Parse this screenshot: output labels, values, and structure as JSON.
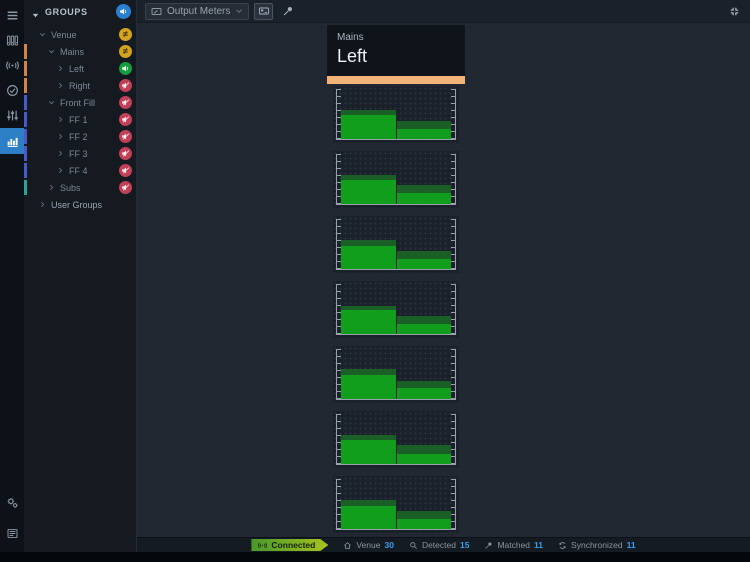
{
  "colors": {
    "accent_orange": "#f2b279",
    "rail_active_blue": "#2c7fc5",
    "meter_green_bright": "#129e1d",
    "meter_green_dark": "#1a5f25",
    "badge_mixed_yellow": "#d3a31f",
    "badge_unmuted_green": "#169b40",
    "badge_muted_red": "#c04058",
    "status_number_blue": "#3f9fe8",
    "group_bar_orange": "#cd854f",
    "group_bar_indigo": "#4a5ac2",
    "group_bar_teal": "#2ea39b"
  },
  "rail": {
    "items": [
      {
        "name": "rail-item-menu",
        "icon": "menu-icon",
        "active": false
      },
      {
        "name": "rail-item-amplifiers",
        "icon": "amplifiers-icon",
        "active": false
      },
      {
        "name": "rail-item-network",
        "icon": "signal-icon",
        "active": false
      },
      {
        "name": "rail-item-check",
        "icon": "check-circle-icon",
        "active": false
      },
      {
        "name": "rail-item-tuning",
        "icon": "eq-sliders-icon",
        "active": false
      },
      {
        "name": "rail-item-meters",
        "icon": "bar-meters-icon",
        "active": true
      }
    ],
    "bottom_items": [
      {
        "name": "rail-item-settings",
        "icon": "gears-icon",
        "active": false
      },
      {
        "name": "rail-item-log",
        "icon": "news-icon",
        "active": false
      }
    ]
  },
  "groups_panel": {
    "header": {
      "label": "GROUPS"
    },
    "tree": [
      {
        "label": "Venue",
        "level": 1,
        "expanded": true,
        "color": null,
        "badge": "mixed"
      },
      {
        "label": "Mains",
        "level": 2,
        "expanded": true,
        "color": "#cd854f",
        "badge": "mixed"
      },
      {
        "label": "Left",
        "level": 3,
        "expanded": false,
        "color": "#cd854f",
        "badge": "unmuted"
      },
      {
        "label": "Right",
        "level": 3,
        "expanded": false,
        "color": "#cd854f",
        "badge": "muted"
      },
      {
        "label": "Front Fill",
        "level": 2,
        "expanded": true,
        "color": "#4a5ac2",
        "badge": "muted"
      },
      {
        "label": "FF 1",
        "level": 3,
        "expanded": false,
        "color": "#4a5ac2",
        "badge": "muted"
      },
      {
        "label": "FF 2",
        "level": 3,
        "expanded": false,
        "color": "#4a5ac2",
        "badge": "muted"
      },
      {
        "label": "FF 3",
        "level": 3,
        "expanded": false,
        "color": "#4a5ac2",
        "badge": "muted"
      },
      {
        "label": "FF 4",
        "level": 3,
        "expanded": false,
        "color": "#4a5ac2",
        "badge": "muted"
      },
      {
        "label": "Subs",
        "level": 2,
        "expanded": false,
        "color": "#2ea39b",
        "badge": "muted"
      },
      {
        "label": "User Groups",
        "level": 1,
        "expanded": false,
        "color": null,
        "badge": null,
        "bright": true
      }
    ]
  },
  "topbar": {
    "meter_select": {
      "label": "Output Meters"
    },
    "buttons": [
      {
        "name": "card-view-button",
        "icon": "id-card-icon",
        "active": true
      },
      {
        "name": "microphone-button",
        "icon": "microphone-icon",
        "active": false
      }
    ]
  },
  "meter_panel": {
    "group_label": "Mains",
    "channel_label": "Left"
  },
  "chart_data": {
    "type": "bar",
    "title": "Output Meters - Mains Left",
    "note": "7 stacked dual-channel level meters; values are percent of full scale (bright = RMS level, dark = peak segment top)",
    "meters": [
      {
        "left": {
          "rms": 48,
          "peak": 60
        },
        "right": {
          "rms": 20,
          "peak": 36
        }
      },
      {
        "left": {
          "rms": 50,
          "peak": 59
        },
        "right": {
          "rms": 22,
          "peak": 38
        }
      },
      {
        "left": {
          "rms": 47,
          "peak": 60
        },
        "right": {
          "rms": 21,
          "peak": 37
        }
      },
      {
        "left": {
          "rms": 49,
          "peak": 58
        },
        "right": {
          "rms": 20,
          "peak": 36
        }
      },
      {
        "left": {
          "rms": 48,
          "peak": 61
        },
        "right": {
          "rms": 22,
          "peak": 37
        }
      },
      {
        "left": {
          "rms": 50,
          "peak": 60
        },
        "right": {
          "rms": 21,
          "peak": 38
        }
      },
      {
        "left": {
          "rms": 47,
          "peak": 59
        },
        "right": {
          "rms": 20,
          "peak": 36
        }
      }
    ]
  },
  "statusbar": {
    "connection": {
      "label": "Connected"
    },
    "items": [
      {
        "name": "status-venue",
        "icon": "house-icon",
        "label": "Venue",
        "value": "30"
      },
      {
        "name": "status-detected",
        "icon": "magnifier-icon",
        "label": "Detected",
        "value": "15"
      },
      {
        "name": "status-matched",
        "icon": "microphone-icon",
        "label": "Matched",
        "value": "11"
      },
      {
        "name": "status-synchronized",
        "icon": "sync-icon",
        "label": "Synchronized",
        "value": "11"
      }
    ]
  }
}
